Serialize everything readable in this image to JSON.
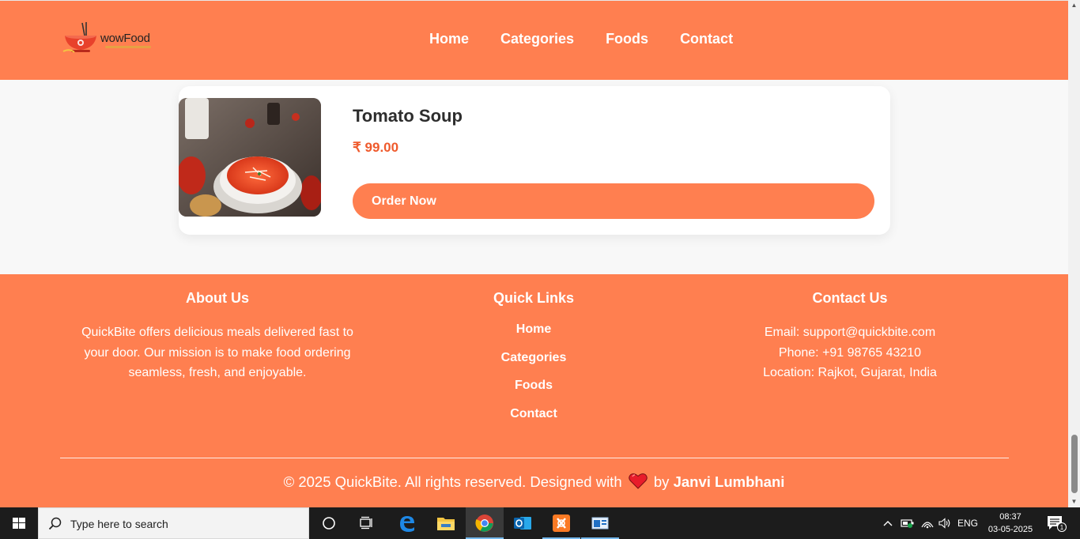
{
  "site": {
    "logo_text": "wowFood"
  },
  "nav": {
    "items": [
      {
        "label": "Home"
      },
      {
        "label": "Categories"
      },
      {
        "label": "Foods"
      },
      {
        "label": "Contact"
      }
    ]
  },
  "food": {
    "title": "Tomato Soup",
    "price": "₹ 99.00",
    "order_label": "Order Now"
  },
  "footer": {
    "about": {
      "heading": "About Us",
      "text": "QuickBite offers delicious meals delivered fast to your door. Our mission is to make food ordering seamless, fresh, and enjoyable."
    },
    "quick_links": {
      "heading": "Quick Links",
      "items": [
        {
          "label": "Home"
        },
        {
          "label": "Categories"
        },
        {
          "label": "Foods"
        },
        {
          "label": "Contact"
        }
      ]
    },
    "contact": {
      "heading": "Contact Us",
      "email": "Email: support@quickbite.com",
      "phone": "Phone: +91 98765 43210",
      "location": "Location: Rajkot, Gujarat, India"
    },
    "copyright_prefix": "© 2025 QuickBite. All rights reserved. Designed with",
    "copyright_by": "by",
    "author": "Janvi Lumbhani"
  },
  "taskbar": {
    "search_placeholder": "Type here to search",
    "language": "ENG",
    "time": "08:37",
    "date": "03-05-2025",
    "notification_count": "1"
  },
  "colors": {
    "brand": "#ff7f50",
    "price": "#ef5a2c",
    "card_bg": "#ffffff",
    "page_bg": "#f8f8f8"
  }
}
